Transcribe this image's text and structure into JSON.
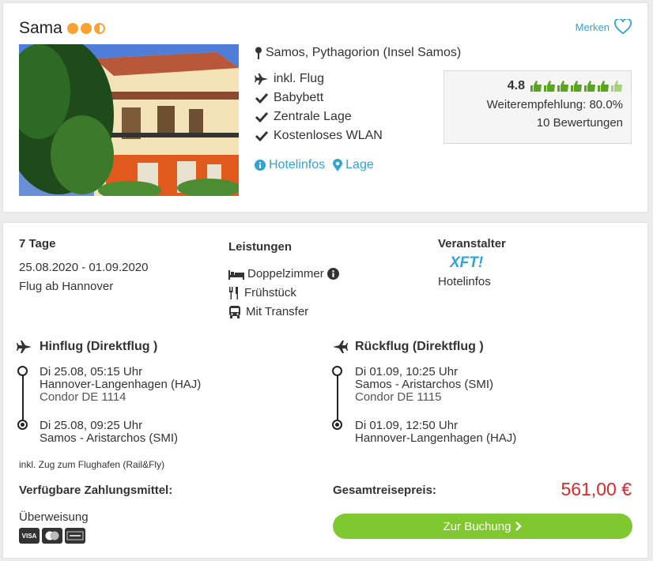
{
  "hotel": {
    "name": "Sama",
    "location": "Samos, Pythagorion (Insel Samos)",
    "features": [
      "inkl. Flug",
      "Babybett",
      "Zentrale Lage",
      "Kostenloses WLAN"
    ],
    "links": {
      "info": "Hotelinfos",
      "map": "Lage"
    },
    "merken": "Merken",
    "rating": {
      "score": "4.8",
      "recommendation": "Weiterempfehlung: 80.0%",
      "reviews": "10 Bewertungen"
    }
  },
  "trip": {
    "duration": "7 Tage",
    "dates": "25.08.2020 - 01.09.2020",
    "departure": "Flug ab Hannover",
    "services_title": "Leistungen",
    "services": [
      "Doppelzimmer",
      "Frühstück",
      "Mit Transfer"
    ],
    "operator_title": "Veranstalter",
    "operator_logo": "XFT!",
    "operator_link": "Hotelinfos"
  },
  "outbound": {
    "title": "Hinflug (Direktflug )",
    "dep_time": "Di 25.08, 05:15 Uhr",
    "dep_airport": "Hannover-Langenhagen (HAJ)",
    "flight_no": "Condor DE 1114",
    "arr_time": "Di 25.08, 09:25 Uhr",
    "arr_airport": "Samos - Aristarchos (SMI)"
  },
  "return": {
    "title": "Rückflug (Direktflug )",
    "dep_time": "Di 01.09, 10:25 Uhr",
    "dep_airport": "Samos - Aristarchos (SMI)",
    "flight_no": "Condor DE 1115",
    "arr_time": "Di 01.09, 12:50 Uhr",
    "arr_airport": "Hannover-Langenhagen (HAJ)"
  },
  "rail_note": "inkl. Zug zum Flughafen (Rail&Fly)",
  "payment": {
    "title": "Verfügbare Zahlungsmittel:",
    "method": "Überweisung",
    "cards": [
      "VISA",
      "MC",
      "AMEX"
    ]
  },
  "total": {
    "label": "Gesamtreisepreis:",
    "price": "561,00 €"
  },
  "book_button": "Zur Buchung",
  "colors": {
    "accent": "#2fa4d6",
    "price": "#e0262b",
    "button": "#7fc830",
    "sun": "#f7a233",
    "thumb": "#5aa51e"
  }
}
